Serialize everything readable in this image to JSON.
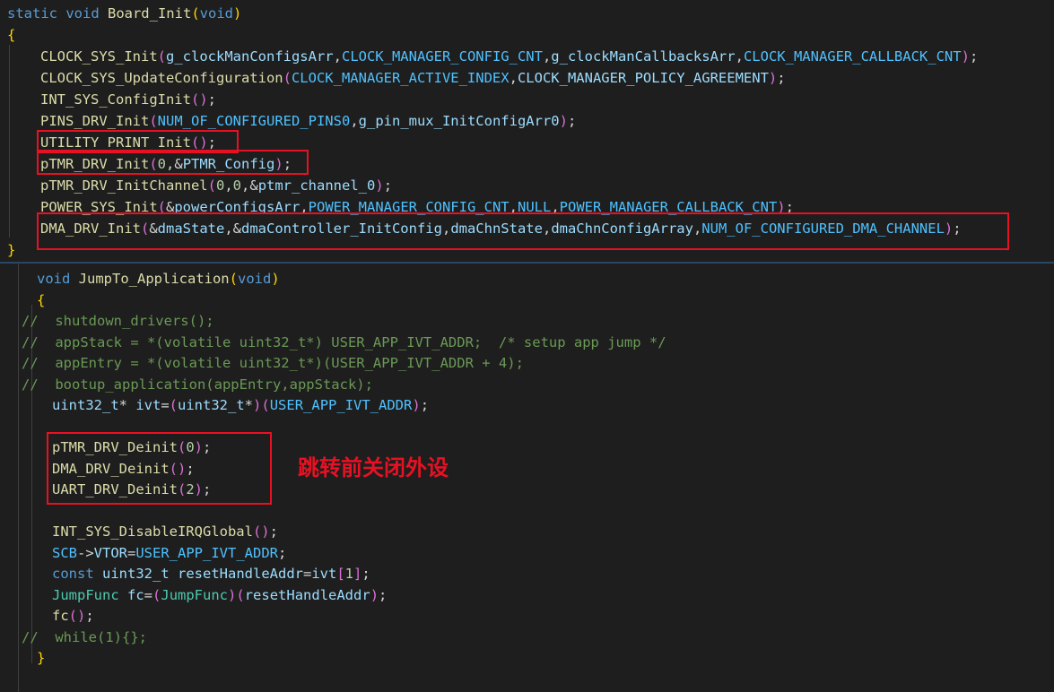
{
  "colors": {
    "keyword": "#569cd6",
    "function": "#dcdcaa",
    "macro": "#4fc1ff",
    "variable": "#9cdcfe",
    "type": "#4ec9b0",
    "number": "#b5cea8",
    "comment": "#6a9955",
    "text": "#d4d4d4",
    "bracket1": "#ffd700",
    "bracket2": "#da70d6",
    "bracket3": "#179fff",
    "annotation": "#e81123"
  },
  "top_code": [
    {
      "indent": 0,
      "tokens": [
        {
          "t": "static void ",
          "c": "keyword"
        },
        {
          "t": "Board_Init",
          "c": "function"
        },
        {
          "t": "(",
          "c": "bracket1"
        },
        {
          "t": "void",
          "c": "keyword"
        },
        {
          "t": ")",
          "c": "bracket1"
        }
      ]
    },
    {
      "indent": 0,
      "tokens": [
        {
          "t": "{",
          "c": "bracket1"
        }
      ]
    },
    {
      "indent": 1,
      "tokens": [
        {
          "t": "CLOCK_SYS_Init",
          "c": "function"
        },
        {
          "t": "(",
          "c": "bracket2"
        },
        {
          "t": "g_clockManConfigsArr",
          "c": "variable"
        },
        {
          "t": ",",
          "c": "text"
        },
        {
          "t": "CLOCK_MANAGER_CONFIG_CNT",
          "c": "macro"
        },
        {
          "t": ",",
          "c": "text"
        },
        {
          "t": "g_clockManCallbacksArr",
          "c": "variable"
        },
        {
          "t": ",",
          "c": "text"
        },
        {
          "t": "CLOCK_MANAGER_CALLBACK_CNT",
          "c": "macro"
        },
        {
          "t": ")",
          "c": "bracket2"
        },
        {
          "t": ";",
          "c": "text"
        }
      ]
    },
    {
      "indent": 1,
      "tokens": [
        {
          "t": "CLOCK_SYS_UpdateConfiguration",
          "c": "function"
        },
        {
          "t": "(",
          "c": "bracket2"
        },
        {
          "t": "CLOCK_MANAGER_ACTIVE_INDEX",
          "c": "macro"
        },
        {
          "t": ",",
          "c": "text"
        },
        {
          "t": "CLOCK_MANAGER_POLICY_AGREEMENT",
          "c": "variable"
        },
        {
          "t": ")",
          "c": "bracket2"
        },
        {
          "t": ";",
          "c": "text"
        }
      ]
    },
    {
      "indent": 1,
      "tokens": [
        {
          "t": "INT_SYS_ConfigInit",
          "c": "function"
        },
        {
          "t": "()",
          "c": "bracket2"
        },
        {
          "t": ";",
          "c": "text"
        }
      ]
    },
    {
      "indent": 1,
      "tokens": [
        {
          "t": "PINS_DRV_Init",
          "c": "function"
        },
        {
          "t": "(",
          "c": "bracket2"
        },
        {
          "t": "NUM_OF_CONFIGURED_PINS0",
          "c": "macro"
        },
        {
          "t": ",",
          "c": "text"
        },
        {
          "t": "g_pin_mux_InitConfigArr0",
          "c": "variable"
        },
        {
          "t": ")",
          "c": "bracket2"
        },
        {
          "t": ";",
          "c": "text"
        }
      ]
    },
    {
      "indent": 1,
      "tokens": [
        {
          "t": "UTILITY_PRINT_Init",
          "c": "function"
        },
        {
          "t": "()",
          "c": "bracket2"
        },
        {
          "t": ";",
          "c": "text"
        }
      ]
    },
    {
      "indent": 1,
      "tokens": [
        {
          "t": "pTMR_DRV_Init",
          "c": "function"
        },
        {
          "t": "(",
          "c": "bracket2"
        },
        {
          "t": "0",
          "c": "number"
        },
        {
          "t": ",&",
          "c": "text"
        },
        {
          "t": "PTMR_Config",
          "c": "variable"
        },
        {
          "t": ")",
          "c": "bracket2"
        },
        {
          "t": ";",
          "c": "text"
        }
      ]
    },
    {
      "indent": 1,
      "tokens": [
        {
          "t": "pTMR_DRV_InitChannel",
          "c": "function"
        },
        {
          "t": "(",
          "c": "bracket2"
        },
        {
          "t": "0",
          "c": "number"
        },
        {
          "t": ",",
          "c": "text"
        },
        {
          "t": "0",
          "c": "number"
        },
        {
          "t": ",&",
          "c": "text"
        },
        {
          "t": "ptmr_channel_0",
          "c": "variable"
        },
        {
          "t": ")",
          "c": "bracket2"
        },
        {
          "t": ";",
          "c": "text"
        }
      ]
    },
    {
      "indent": 1,
      "tokens": [
        {
          "t": "POWER_SYS_Init",
          "c": "function"
        },
        {
          "t": "(",
          "c": "bracket2"
        },
        {
          "t": "&",
          "c": "text"
        },
        {
          "t": "powerConfigsArr",
          "c": "variable"
        },
        {
          "t": ",",
          "c": "text"
        },
        {
          "t": "POWER_MANAGER_CONFIG_CNT",
          "c": "macro"
        },
        {
          "t": ",",
          "c": "text"
        },
        {
          "t": "NULL",
          "c": "macro"
        },
        {
          "t": ",",
          "c": "text"
        },
        {
          "t": "POWER_MANAGER_CALLBACK_CNT",
          "c": "macro"
        },
        {
          "t": ")",
          "c": "bracket2"
        },
        {
          "t": ";",
          "c": "text"
        }
      ]
    },
    {
      "indent": 1,
      "tokens": [
        {
          "t": "DMA_DRV_Init",
          "c": "function"
        },
        {
          "t": "(",
          "c": "bracket2"
        },
        {
          "t": "&",
          "c": "text"
        },
        {
          "t": "dmaState",
          "c": "variable"
        },
        {
          "t": ",&",
          "c": "text"
        },
        {
          "t": "dmaController_InitConfig",
          "c": "variable"
        },
        {
          "t": ",",
          "c": "text"
        },
        {
          "t": "dmaChnState",
          "c": "variable"
        },
        {
          "t": ",",
          "c": "text"
        },
        {
          "t": "dmaChnConfigArray",
          "c": "variable"
        },
        {
          "t": ",",
          "c": "text"
        },
        {
          "t": "NUM_OF_CONFIGURED_DMA_CHANNEL",
          "c": "macro"
        },
        {
          "t": ")",
          "c": "bracket2"
        },
        {
          "t": ";",
          "c": "text"
        }
      ]
    },
    {
      "indent": 0,
      "tokens": [
        {
          "t": "}",
          "c": "bracket1"
        }
      ]
    }
  ],
  "bottom_code": [
    {
      "indent": 1,
      "tokens": [
        {
          "t": "void ",
          "c": "keyword"
        },
        {
          "t": "JumpTo_Application",
          "c": "function"
        },
        {
          "t": "(",
          "c": "bracket1"
        },
        {
          "t": "void",
          "c": "keyword"
        },
        {
          "t": ")",
          "c": "bracket1"
        }
      ]
    },
    {
      "indent": 1,
      "tokens": [
        {
          "t": "{",
          "c": "bracket1"
        }
      ]
    },
    {
      "indent": 0,
      "tokens": [
        {
          "t": "//  shutdown_drivers();",
          "c": "comment"
        }
      ]
    },
    {
      "indent": 0,
      "tokens": [
        {
          "t": "//  appStack = *(volatile uint32_t*) USER_APP_IVT_ADDR;  /* setup app jump */",
          "c": "comment"
        }
      ]
    },
    {
      "indent": 0,
      "tokens": [
        {
          "t": "//  appEntry = *(volatile uint32_t*)(USER_APP_IVT_ADDR + 4);",
          "c": "comment"
        }
      ]
    },
    {
      "indent": 0,
      "tokens": [
        {
          "t": "//  bootup_application(appEntry,appStack);",
          "c": "comment"
        }
      ]
    },
    {
      "indent": 2,
      "tokens": [
        {
          "t": "uint32_t",
          "c": "variable"
        },
        {
          "t": "* ",
          "c": "text"
        },
        {
          "t": "ivt",
          "c": "variable"
        },
        {
          "t": "=",
          "c": "text"
        },
        {
          "t": "(",
          "c": "bracket2"
        },
        {
          "t": "uint32_t",
          "c": "variable"
        },
        {
          "t": "*",
          "c": "text"
        },
        {
          "t": ")",
          "c": "bracket2"
        },
        {
          "t": "(",
          "c": "bracket2"
        },
        {
          "t": "USER_APP_IVT_ADDR",
          "c": "macro"
        },
        {
          "t": ")",
          "c": "bracket2"
        },
        {
          "t": ";",
          "c": "text"
        }
      ]
    },
    {
      "indent": 0,
      "tokens": []
    },
    {
      "indent": 2,
      "tokens": [
        {
          "t": "pTMR_DRV_Deinit",
          "c": "function"
        },
        {
          "t": "(",
          "c": "bracket2"
        },
        {
          "t": "0",
          "c": "number"
        },
        {
          "t": ")",
          "c": "bracket2"
        },
        {
          "t": ";",
          "c": "text"
        }
      ]
    },
    {
      "indent": 2,
      "tokens": [
        {
          "t": "DMA_DRV_Deinit",
          "c": "function"
        },
        {
          "t": "()",
          "c": "bracket2"
        },
        {
          "t": ";",
          "c": "text"
        }
      ]
    },
    {
      "indent": 2,
      "tokens": [
        {
          "t": "UART_DRV_Deinit",
          "c": "function"
        },
        {
          "t": "(",
          "c": "bracket2"
        },
        {
          "t": "2",
          "c": "number"
        },
        {
          "t": ")",
          "c": "bracket2"
        },
        {
          "t": ";",
          "c": "text"
        }
      ]
    },
    {
      "indent": 0,
      "tokens": []
    },
    {
      "indent": 2,
      "tokens": [
        {
          "t": "INT_SYS_DisableIRQGlobal",
          "c": "function"
        },
        {
          "t": "()",
          "c": "bracket2"
        },
        {
          "t": ";",
          "c": "text"
        }
      ]
    },
    {
      "indent": 2,
      "tokens": [
        {
          "t": "SCB",
          "c": "macro"
        },
        {
          "t": "->",
          "c": "text"
        },
        {
          "t": "VTOR",
          "c": "variable"
        },
        {
          "t": "=",
          "c": "text"
        },
        {
          "t": "USER_APP_IVT_ADDR",
          "c": "macro"
        },
        {
          "t": ";",
          "c": "text"
        }
      ]
    },
    {
      "indent": 2,
      "tokens": [
        {
          "t": "const ",
          "c": "keyword"
        },
        {
          "t": "uint32_t",
          "c": "variable"
        },
        {
          "t": " ",
          "c": "text"
        },
        {
          "t": "resetHandleAddr",
          "c": "variable"
        },
        {
          "t": "=",
          "c": "text"
        },
        {
          "t": "ivt",
          "c": "variable"
        },
        {
          "t": "[",
          "c": "bracket2"
        },
        {
          "t": "1",
          "c": "number"
        },
        {
          "t": "]",
          "c": "bracket2"
        },
        {
          "t": ";",
          "c": "text"
        }
      ]
    },
    {
      "indent": 2,
      "tokens": [
        {
          "t": "JumpFunc",
          "c": "type"
        },
        {
          "t": " ",
          "c": "text"
        },
        {
          "t": "fc",
          "c": "variable"
        },
        {
          "t": "=",
          "c": "text"
        },
        {
          "t": "(",
          "c": "bracket2"
        },
        {
          "t": "JumpFunc",
          "c": "type"
        },
        {
          "t": ")",
          "c": "bracket2"
        },
        {
          "t": "(",
          "c": "bracket2"
        },
        {
          "t": "resetHandleAddr",
          "c": "variable"
        },
        {
          "t": ")",
          "c": "bracket2"
        },
        {
          "t": ";",
          "c": "text"
        }
      ]
    },
    {
      "indent": 2,
      "tokens": [
        {
          "t": "fc",
          "c": "function"
        },
        {
          "t": "()",
          "c": "bracket2"
        },
        {
          "t": ";",
          "c": "text"
        }
      ]
    },
    {
      "indent": 0,
      "tokens": [
        {
          "t": "//  while(1){};",
          "c": "comment"
        }
      ]
    },
    {
      "indent": 1,
      "tokens": [
        {
          "t": "}",
          "c": "bracket1"
        }
      ]
    }
  ],
  "annotation": {
    "text": "跳转前关闭外设"
  }
}
